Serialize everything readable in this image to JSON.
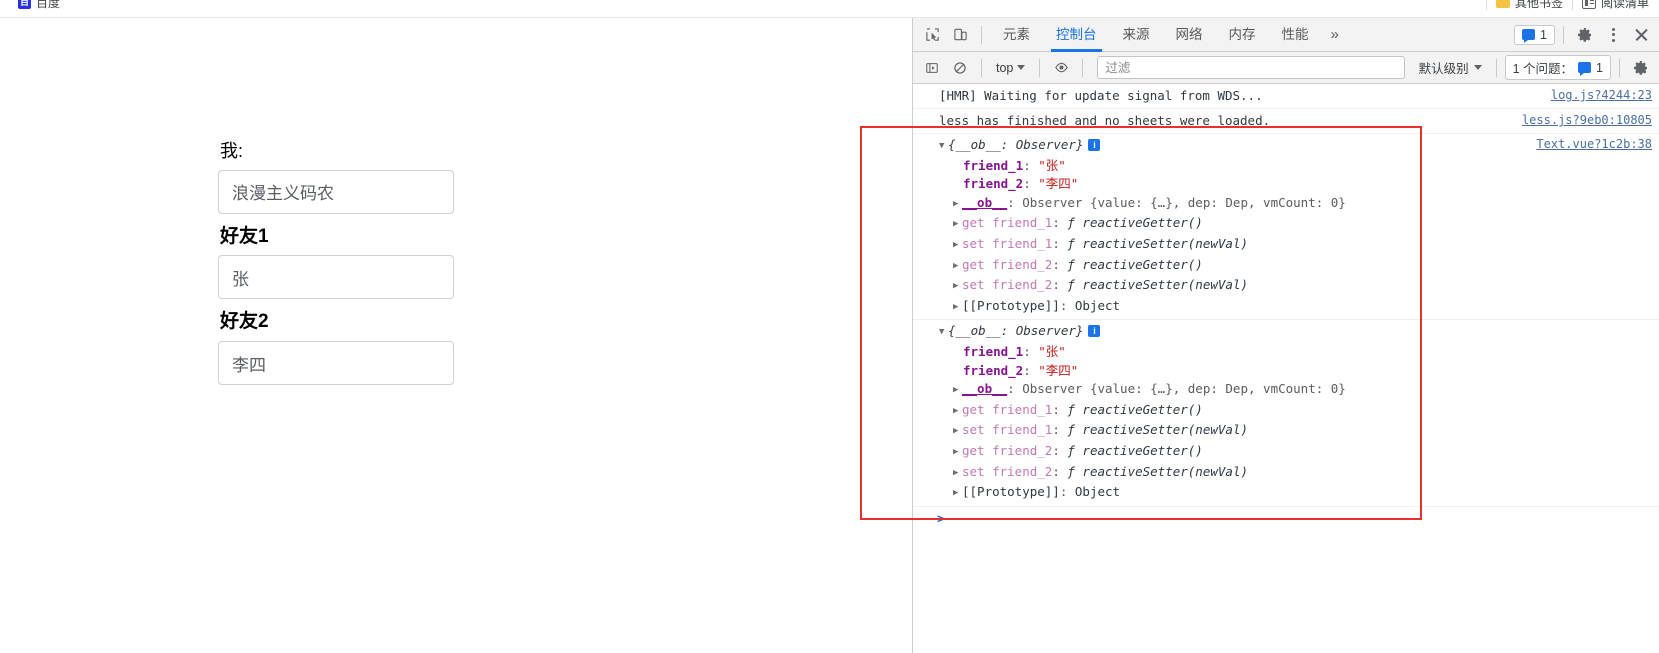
{
  "browser": {
    "bookmarks_left": [
      {
        "label": "百度",
        "icon": "baidu-favicon"
      }
    ],
    "bookmarks_right": [
      {
        "label": "其他书签",
        "icon": "folder-icon"
      },
      {
        "label": "阅读清单",
        "icon": "reading-list-icon"
      }
    ]
  },
  "page": {
    "fields": [
      {
        "label": "我:",
        "value": "浪漫主义码农",
        "name": "me"
      },
      {
        "label": "好友1",
        "value": "张",
        "name": "friend-1"
      },
      {
        "label": "好友2",
        "value": "李四",
        "name": "friend-2"
      }
    ]
  },
  "devtools": {
    "toolbar": {
      "inspect_icon": "inspect-element-icon",
      "device_icon": "device-toolbar-icon",
      "tabs": [
        {
          "label": "元素",
          "active": false
        },
        {
          "label": "控制台",
          "active": true
        },
        {
          "label": "来源",
          "active": false
        },
        {
          "label": "网络",
          "active": false
        },
        {
          "label": "内存",
          "active": false
        },
        {
          "label": "性能",
          "active": false
        }
      ],
      "more_tabs": "»",
      "issues_count": "1",
      "settings_icon": "gear-icon",
      "kebab_icon": "more-options-icon",
      "close_icon": "close-icon"
    },
    "filterbar": {
      "sidebar_icon": "console-sidebar-icon",
      "clear_icon": "clear-console-icon",
      "context": "top",
      "eye_icon": "live-expression-icon",
      "filter_placeholder": "过滤",
      "filter_value": "",
      "level": "默认级别",
      "issues_label": "1 个问题：",
      "issues_count": "1",
      "settings_icon": "gear-icon"
    },
    "console": {
      "messages": [
        {
          "text": "[HMR] Waiting for update signal from WDS...",
          "source": "log.js?4244:23"
        },
        {
          "text": "less has finished and no sheets were loaded.",
          "source": "less.js?9eb0:10805"
        }
      ],
      "objects": [
        {
          "source": "Text.vue?1c2b:38",
          "header": "{__ob__: Observer}",
          "info_badge": "i",
          "props": [
            {
              "key": "friend_1",
              "value": "\"张\"",
              "kind": "own"
            },
            {
              "key": "friend_2",
              "value": "\"李四\"",
              "kind": "own"
            },
            {
              "key": "__ob__",
              "value": "Observer {value: {…}, dep: Dep, vmCount: 0}",
              "kind": "ob"
            },
            {
              "key": "get friend_1",
              "value": "ƒ reactiveGetter()",
              "kind": "accessor"
            },
            {
              "key": "set friend_1",
              "value": "ƒ reactiveSetter(newVal)",
              "kind": "accessor"
            },
            {
              "key": "get friend_2",
              "value": "ƒ reactiveGetter()",
              "kind": "accessor"
            },
            {
              "key": "set friend_2",
              "value": "ƒ reactiveSetter(newVal)",
              "kind": "accessor"
            },
            {
              "key": "[[Prototype]]",
              "value": "Object",
              "kind": "proto"
            }
          ]
        },
        {
          "source": "",
          "header": "{__ob__: Observer}",
          "info_badge": "i",
          "props": [
            {
              "key": "friend_1",
              "value": "\"张\"",
              "kind": "own"
            },
            {
              "key": "friend_2",
              "value": "\"李四\"",
              "kind": "own"
            },
            {
              "key": "__ob__",
              "value": "Observer {value: {…}, dep: Dep, vmCount: 0}",
              "kind": "ob"
            },
            {
              "key": "get friend_1",
              "value": "ƒ reactiveGetter()",
              "kind": "accessor"
            },
            {
              "key": "set friend_1",
              "value": "ƒ reactiveSetter(newVal)",
              "kind": "accessor"
            },
            {
              "key": "get friend_2",
              "value": "ƒ reactiveGetter()",
              "kind": "accessor"
            },
            {
              "key": "set friend_2",
              "value": "ƒ reactiveSetter(newVal)",
              "kind": "accessor"
            },
            {
              "key": "[[Prototype]]",
              "value": "Object",
              "kind": "proto"
            }
          ]
        }
      ],
      "prompt": ">"
    }
  },
  "annotation": {
    "color": "#e8312a"
  }
}
